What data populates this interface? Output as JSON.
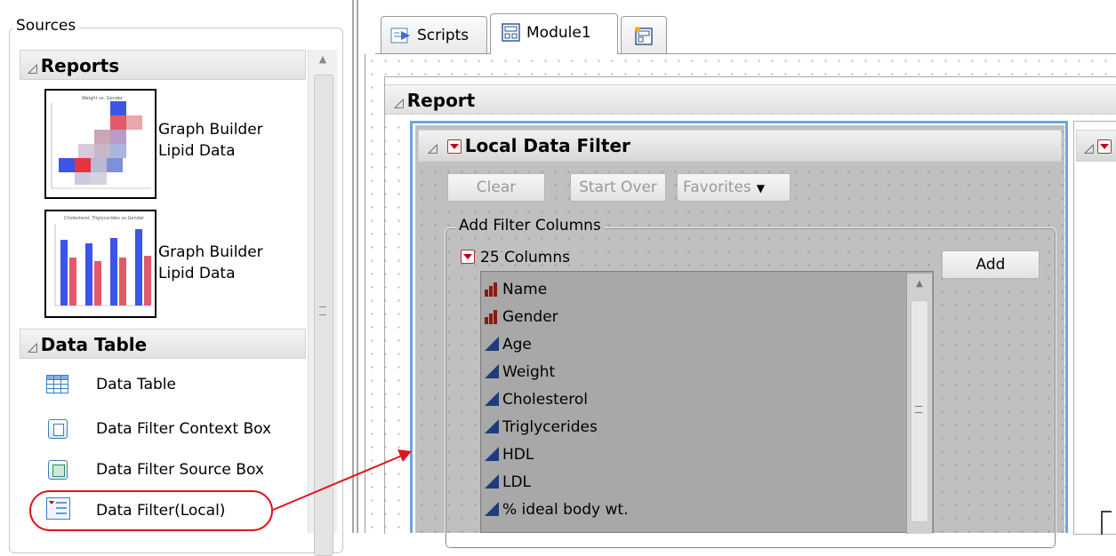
{
  "sources": {
    "legend": "Sources",
    "reports": {
      "title": "Reports",
      "items": [
        {
          "line1": "Graph Builder",
          "line2": "Lipid Data"
        },
        {
          "line1": "Graph Builder",
          "line2": "Lipid Data"
        }
      ]
    },
    "data_table": {
      "title": "Data Table",
      "items": [
        {
          "label": "Data Table",
          "icon": "table-grid-icon"
        },
        {
          "label": "Data Filter Context Box",
          "icon": "context-box-icon"
        },
        {
          "label": "Data Filter Source Box",
          "icon": "source-box-icon"
        },
        {
          "label": "Data Filter(Local)",
          "icon": "local-filter-icon"
        }
      ]
    }
  },
  "tabs": [
    {
      "label": "Scripts",
      "icon": "scripts-icon"
    },
    {
      "label": "Module1",
      "icon": "module-icon"
    },
    {
      "label": "",
      "icon": "new-module-icon"
    }
  ],
  "report": {
    "title": "Report",
    "filter": {
      "title": "Local Data Filter",
      "buttons": {
        "clear": "Clear",
        "start_over": "Start Over",
        "favorites": "Favorites"
      },
      "add_group": {
        "legend": "Add Filter Columns",
        "count_label": "25 Columns",
        "add_button": "Add",
        "columns": [
          {
            "name": "Name",
            "type": "nominal"
          },
          {
            "name": "Gender",
            "type": "nominal"
          },
          {
            "name": "Age",
            "type": "continuous"
          },
          {
            "name": "Weight",
            "type": "continuous"
          },
          {
            "name": "Cholesterol",
            "type": "continuous"
          },
          {
            "name": "Triglycerides",
            "type": "continuous"
          },
          {
            "name": "HDL",
            "type": "continuous"
          },
          {
            "name": "LDL",
            "type": "continuous"
          },
          {
            "name": "% ideal body wt.",
            "type": "continuous"
          }
        ]
      }
    }
  },
  "colors": {
    "highlight_ring": "#e0141e",
    "arrow": "#e0141e",
    "selection_border": "#6aa6e0"
  }
}
